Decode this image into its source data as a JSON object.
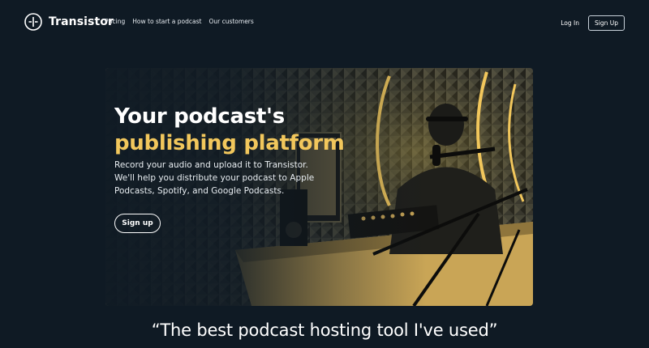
{
  "brand": {
    "name": "Transistor"
  },
  "nav": {
    "links": [
      "Pricing",
      "How to start a podcast",
      "Our customers"
    ],
    "login_label": "Log In",
    "signup_label": "Sign Up"
  },
  "hero": {
    "title_line1": "Your podcast's",
    "title_line2": "publishing platform",
    "description": "Record your audio and upload it to Transistor. We'll help you distribute your podcast to Apple Podcasts, Spotify, and Google Podcasts.",
    "cta_label": "Sign up"
  },
  "quote": {
    "text": "“The best podcast hosting tool I've used”"
  },
  "colors": {
    "background": "#0f1a24",
    "accent": "#f2c75c",
    "text": "#ffffff"
  },
  "icons": {
    "logo": "transistor-logo-icon"
  }
}
